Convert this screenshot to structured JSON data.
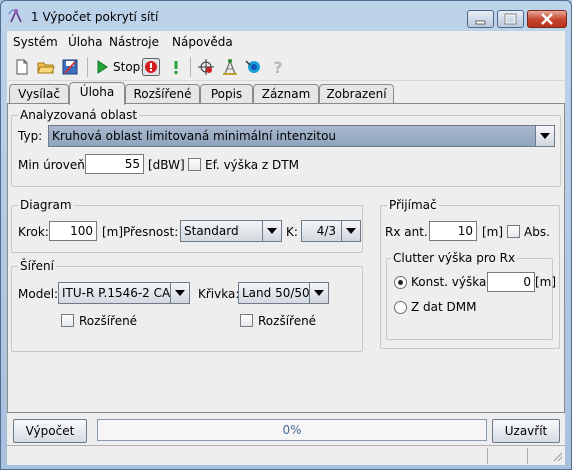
{
  "window": {
    "title": "1 Výpočet pokrytí sítí"
  },
  "menu": {
    "items": [
      "Systém",
      "Úloha",
      "Nástroje",
      "Nápověda"
    ]
  },
  "toolbar": {
    "stop_label": "Stop:"
  },
  "tabs": [
    "Vysílač",
    "Úloha",
    "Rozšířené",
    "Popis",
    "Záznam",
    "Zobrazení"
  ],
  "active_tab": "Úloha",
  "analyzed_area": {
    "title": "Analyzovaná oblast",
    "type_label": "Typ:",
    "type_value": "Kruhová oblast limitovaná minimální intenzitou",
    "min_level_label": "Min úroveň:",
    "min_level_value": "55",
    "min_level_unit": "[dBW]",
    "dtm_label": "Ef. výška z DTM"
  },
  "diagram": {
    "title": "Diagram",
    "step_label": "Krok:",
    "step_value": "100",
    "step_unit": "[m]",
    "precision_label": "Přesnost:",
    "precision_value": "Standard",
    "k_label": "K:",
    "k_value": "4/3"
  },
  "propagation": {
    "title": "Šíření",
    "model_label": "Model:",
    "model_value": "ITU-R P.1546-2 CA",
    "curve_label": "Křivka:",
    "curve_value": "Land 50/50",
    "extended1_label": "Rozšířené",
    "extended2_label": "Rozšířené"
  },
  "receiver": {
    "title": "Přijímač",
    "rx_ant_label": "Rx ant.:",
    "rx_ant_value": "10",
    "rx_ant_unit": "[m]",
    "abs_label": "Abs.",
    "clutter_title": "Clutter výška pro Rx",
    "const_height_label": "Konst. výška:",
    "const_height_value": "0",
    "const_height_unit": "[m]",
    "dmm_label": "Z dat DMM"
  },
  "bottom": {
    "compute_label": "Výpočet",
    "progress_text": "0%",
    "progress_value": 0,
    "close_label": "Uzavřít"
  }
}
